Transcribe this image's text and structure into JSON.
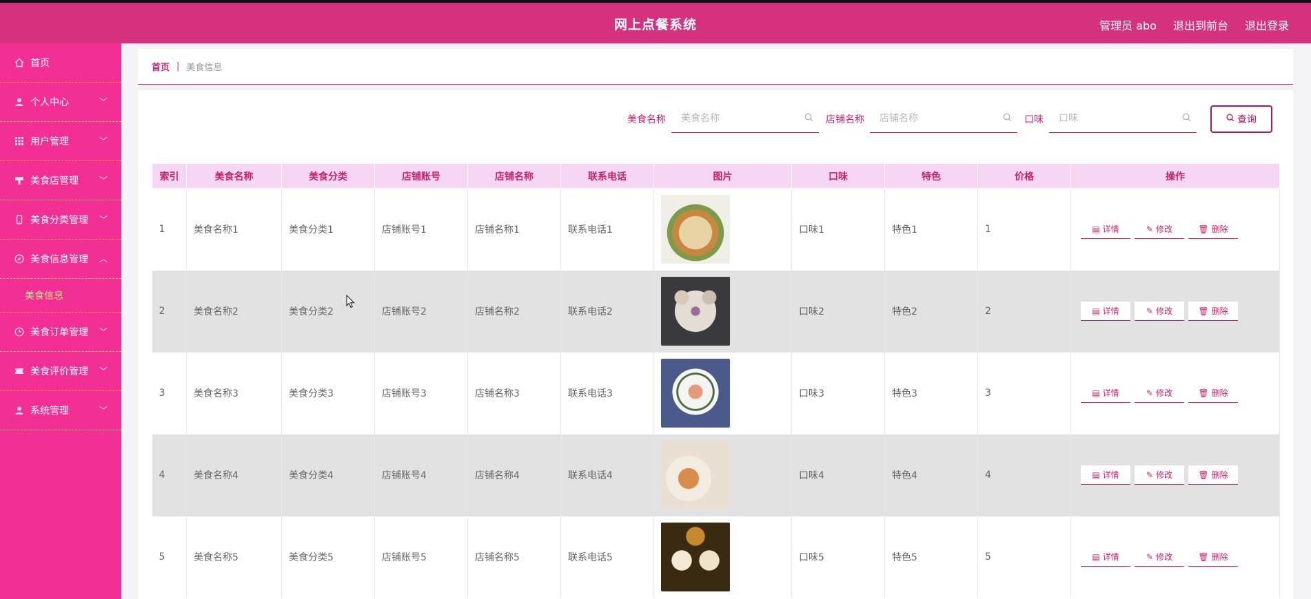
{
  "header": {
    "title": "网上点餐系统",
    "admin": "管理员 abo",
    "front": "退出到前台",
    "logout": "退出登录"
  },
  "sidebar": {
    "items": [
      {
        "label": "首页",
        "icon": "home-icon"
      },
      {
        "label": "个人中心",
        "icon": "user-icon",
        "arrow": "﹀"
      },
      {
        "label": "用户管理",
        "icon": "grid-icon",
        "arrow": "﹀"
      },
      {
        "label": "美食店管理",
        "icon": "shop-icon",
        "arrow": "﹀"
      },
      {
        "label": "美食分类管理",
        "icon": "phone-icon",
        "arrow": "﹀"
      },
      {
        "label": "美食信息管理",
        "icon": "compass-icon",
        "arrow": "︿"
      },
      {
        "label": "美食订单管理",
        "icon": "clock-icon",
        "arrow": "﹀"
      },
      {
        "label": "美食评价管理",
        "icon": "ticket-icon",
        "arrow": "﹀"
      },
      {
        "label": "系统管理",
        "icon": "user-icon",
        "arrow": "﹀"
      }
    ],
    "submenu": "美食信息"
  },
  "breadcrumb": {
    "home": "首页",
    "sep": "|",
    "current": "美食信息"
  },
  "search": {
    "name_label": "美食名称",
    "name_placeholder": "美食名称",
    "shop_label": "店铺名称",
    "shop_placeholder": "店铺名称",
    "taste_label": "口味",
    "taste_placeholder": "口味",
    "query": "查询"
  },
  "table": {
    "headers": [
      "索引",
      "美食名称",
      "美食分类",
      "店铺账号",
      "店铺名称",
      "联系电话",
      "图片",
      "口味",
      "特色",
      "价格",
      "操作"
    ],
    "ops": {
      "detail": "详情",
      "edit": "修改",
      "delete": "删除"
    },
    "rows": [
      {
        "idx": "1",
        "name": "美食名称1",
        "cat": "美食分类1",
        "acct": "店铺账号1",
        "shop": "店铺名称1",
        "phone": "联系电话1",
        "taste": "口味1",
        "feature": "特色1",
        "price": "1"
      },
      {
        "idx": "2",
        "name": "美食名称2",
        "cat": "美食分类2",
        "acct": "店铺账号2",
        "shop": "店铺名称2",
        "phone": "联系电话2",
        "taste": "口味2",
        "feature": "特色2",
        "price": "2"
      },
      {
        "idx": "3",
        "name": "美食名称3",
        "cat": "美食分类3",
        "acct": "店铺账号3",
        "shop": "店铺名称3",
        "phone": "联系电话3",
        "taste": "口味3",
        "feature": "特色3",
        "price": "3"
      },
      {
        "idx": "4",
        "name": "美食名称4",
        "cat": "美食分类4",
        "acct": "店铺账号4",
        "shop": "店铺名称4",
        "phone": "联系电话4",
        "taste": "口味4",
        "feature": "特色4",
        "price": "4"
      },
      {
        "idx": "5",
        "name": "美食名称5",
        "cat": "美食分类5",
        "acct": "店铺账号5",
        "shop": "店铺名称5",
        "phone": "联系电话5",
        "taste": "口味5",
        "feature": "特色5",
        "price": "5"
      }
    ]
  },
  "colors": {
    "header": "#d5317f",
    "sidebar": "#f32e95",
    "accent": "#c4246f",
    "thead": "#f7d6f3"
  }
}
